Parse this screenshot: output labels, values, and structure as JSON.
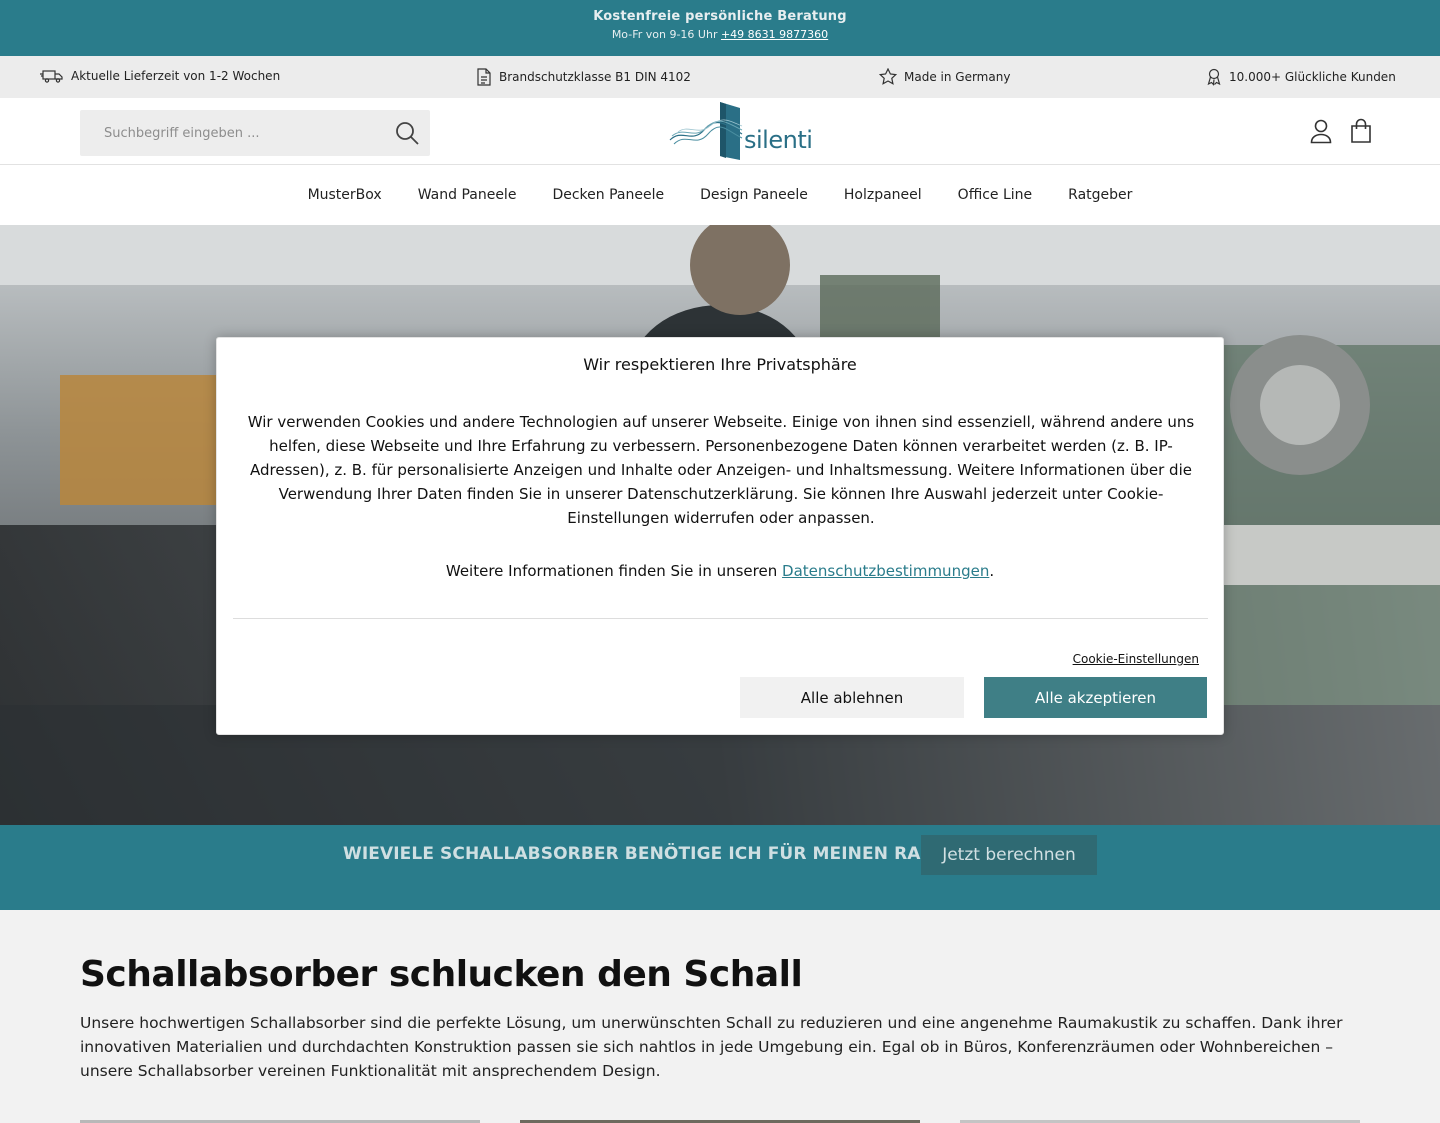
{
  "topbar": {
    "headline": "Kostenfreie persönliche Beratung",
    "hours": "Mo-Fr von 9-16 Uhr",
    "phone": "+49 8631 9877360"
  },
  "usps": [
    {
      "icon": "truck-icon",
      "label": "Aktuelle Lieferzeit von 1-2 Wochen"
    },
    {
      "icon": "document-icon",
      "label": "Brandschutzklasse B1 DIN 4102"
    },
    {
      "icon": "star-icon",
      "label": "Made in Germany"
    },
    {
      "icon": "award-icon",
      "label": "10.000+ Glückliche Kunden"
    }
  ],
  "header": {
    "search_placeholder": "Suchbegriff eingeben ...",
    "logo_text": "silenti"
  },
  "nav": {
    "items": [
      "MusterBox",
      "Wand Paneele",
      "Decken Paneele",
      "Design Paneele",
      "Holzpaneel",
      "Office Line",
      "Ratgeber"
    ]
  },
  "cookie_modal": {
    "title": "Wir respektieren Ihre Privatsphäre",
    "body": "Wir verwenden Cookies und andere Technologien auf unserer Webseite. Einige von ihnen sind essenziell, während andere uns helfen, diese Webseite und Ihre Erfahrung zu verbessern. Personenbezogene Daten können verarbeitet werden (z. B. IP-Adressen), z. B. für personalisierte Anzeigen und Inhalte oder Anzeigen- und Inhaltsmessung. Weitere Informationen über die Verwendung Ihrer Daten finden Sie in unserer Datenschutzerklärung. Sie können Ihre Auswahl jederzeit unter Cookie-Einstellungen widerrufen oder anpassen.",
    "more_prefix": "Weitere Informationen finden Sie in unseren",
    "more_link": "Datenschutzbestimmungen",
    "more_suffix": ".",
    "settings_link": "Cookie-Einstellungen",
    "decline_label": "Alle ablehnen",
    "accept_label": "Alle akzeptieren"
  },
  "calc": {
    "question": "WIEVIELE SCHALLABSORBER BENÖTIGE ICH FÜR MEINEN RAUM?",
    "button": "Jetzt berechnen"
  },
  "content": {
    "heading": "Schallabsorber schlucken den Schall",
    "text": "Unsere hochwertigen Schallabsorber sind die perfekte Lösung, um unerwünschten Schall zu reduzieren und eine angenehme Raumakustik zu schaffen. Dank ihrer innovativen Materialien und durchdachten Konstruktion passen sie sich nahtlos in jede Umgebung ein. Egal ob in Büros, Konferenzräumen oder Wohnbereichen – unsere Schallabsorber vereinen Funktionalität mit ansprechendem Design."
  },
  "colors": {
    "brand_teal": "#2a7c8b",
    "accept_button": "#3f7f86"
  }
}
